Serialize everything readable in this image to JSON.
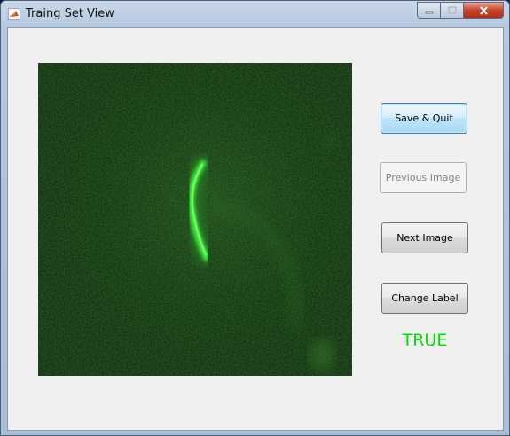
{
  "window": {
    "title": "Traing Set View",
    "controls": {
      "minimize_icon": "minimize-icon",
      "maximize_icon": "maximize-icon",
      "close_icon": "close-icon"
    }
  },
  "buttons": {
    "save_quit": "Save & Quit",
    "previous_image": "Previous Image",
    "next_image": "Next Image",
    "change_label": "Change Label"
  },
  "label": {
    "value": "TRUE",
    "color": "#00e000"
  },
  "image": {
    "description_icon": "fluorescence-microscopy-image",
    "colors": {
      "background": "#0f220c",
      "signal": "#3cff3c"
    }
  }
}
